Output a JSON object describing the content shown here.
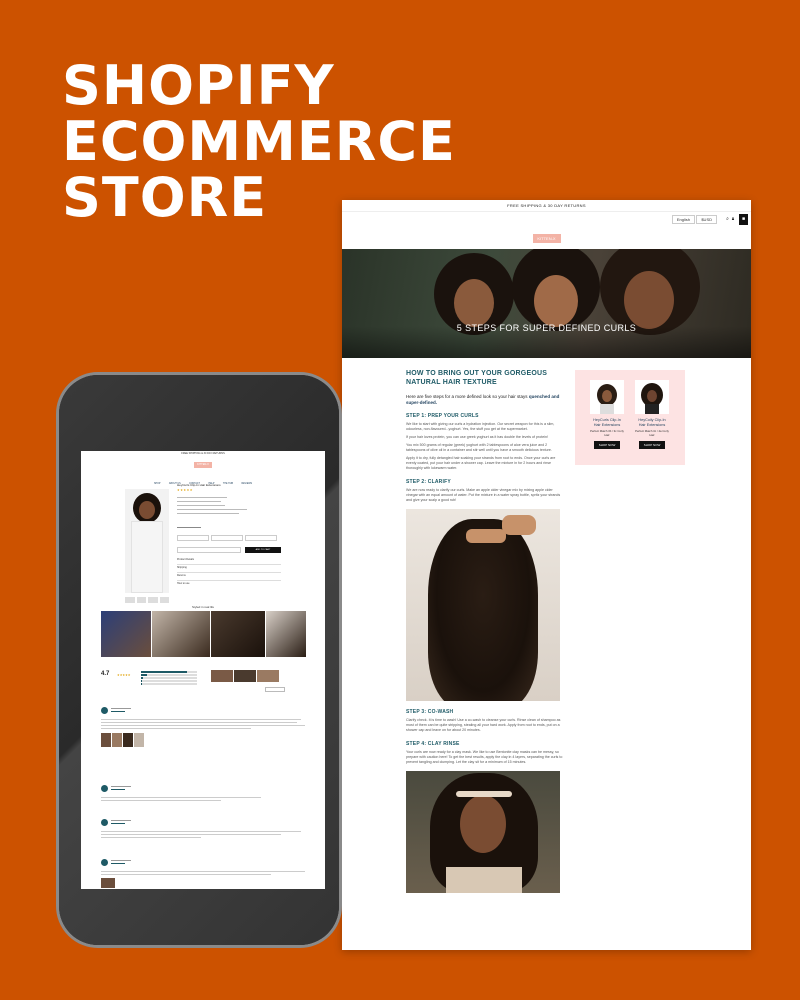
{
  "headline": {
    "line1": "SHOPIFY",
    "line2": "ECOMMERCE",
    "line3": "STORE"
  },
  "colors": {
    "background": "#cc5200",
    "teal_heading": "#1e5a66",
    "navy_nav": "#1b3d5a",
    "logo_pink": "#f3b3a6",
    "sidebar_pink": "#fde3e3"
  },
  "desktop": {
    "announcement": "FREE SHIPPING & 30 DAY RETURNS",
    "language": "English",
    "currency": "$USD",
    "icons": [
      "search-icon",
      "account-icon",
      "cart-icon"
    ],
    "logo": "KITTEN-X",
    "nav": [
      "SHOP ▾",
      "ABOUT US",
      "CONTACT",
      "HELP ▾",
      "THE HUB",
      "REVIEWS"
    ],
    "hero_title": "5 STEPS FOR SUPER DEFINED CURLS",
    "article": {
      "heading": "HOW TO BRING OUT YOUR GORGEOUS NATURAL HAIR TEXTURE",
      "intro_plain": "Here are five steps for a more defined look so your hair stays",
      "intro_bold": "quenched and super-defined.",
      "steps": [
        {
          "title": "STEP 1: PREP YOUR CURLS",
          "paragraphs": [
            "We like to start with giving our curls a hydration injection. Our secret weapon for this is a slim, odourless, non-flavoured...yoghurt. Yes, the stuff you get at the supermarket.",
            "If your hair loves protein, you can use greek yoghurt as it has double the levels of protein!",
            "You mix 500 grams of regular (greek) yoghurt with 2 tablespoons of aloe vera juice and 2 tablespoons of olive oil in a container and stir well until you have a smooth delicious texture.",
            "Apply it to dry, fully detangled hair soaking your strands from root to ends. Once your curls are evenly coated, put your hair under a shower cap. Leave the mixture in for 2 hours and rinse thoroughly with lukewarm water."
          ]
        },
        {
          "title": "STEP 2: CLARIFY",
          "paragraphs": [
            "We are now ready to clarify our curls. Make an apple cider vinegar mix by mixing apple cider vinegar with an equal amount of water. Put the mixture in a water spray bottle, spritz your strands and give your scalp a good rub!"
          ]
        },
        {
          "title": "STEP 3: CO-WASH",
          "paragraphs": [
            "Clarify check. It is time to wash! Use a co-wash to cleanse your curls. Rinse clean of shampoo as most of them can be quite stripping, stealing all your hard work. Apply from root to ends, put on a shower cap and leave on for about 20 minutes."
          ]
        },
        {
          "title": "STEP 4: CLAY RINSE",
          "paragraphs": [
            "Your curls are now ready for a clay mask. We like to use Bentonite clay masks can be messy, so prepare with caution here! To get the best results, apply the clay in 4 layers, separating the curls to prevent tangling and clumping. Let the clay sit for a minimum of 15 minutes."
          ]
        }
      ]
    },
    "sidebar": {
      "products": [
        {
          "title": "HeyCurls Clip-In Hair Extensions",
          "subtitle": "Perfect Match\n3b / 3c Curly Hair",
          "button": "SHOP NOW"
        },
        {
          "title": "HeyCoily Clip-In Hair Extensions",
          "subtitle": "Perfect Match\n3c / 4a Curly Hair",
          "button": "SHOP NOW"
        }
      ]
    }
  },
  "mobile": {
    "announcement": "FREE SHIPPING & 30 DAY RETURNS",
    "logo": "KITTEN-X",
    "nav": [
      "SHOP",
      "ABOUT US",
      "CONTACT",
      "HELP",
      "THE HUB",
      "REVIEWS"
    ],
    "product_title": "HeyCurls Clip-In Hair Extensions",
    "stars": "★★★★★",
    "add_to_cart": "ADD TO CART",
    "accordions": [
      "Product Details",
      "Shipping",
      "Returns",
      "How to use"
    ],
    "styled_heading": "Styled in real life",
    "rating": "4.7",
    "rating_distribution": [
      0.82,
      0.1,
      0.04,
      0.02,
      0.02
    ]
  }
}
